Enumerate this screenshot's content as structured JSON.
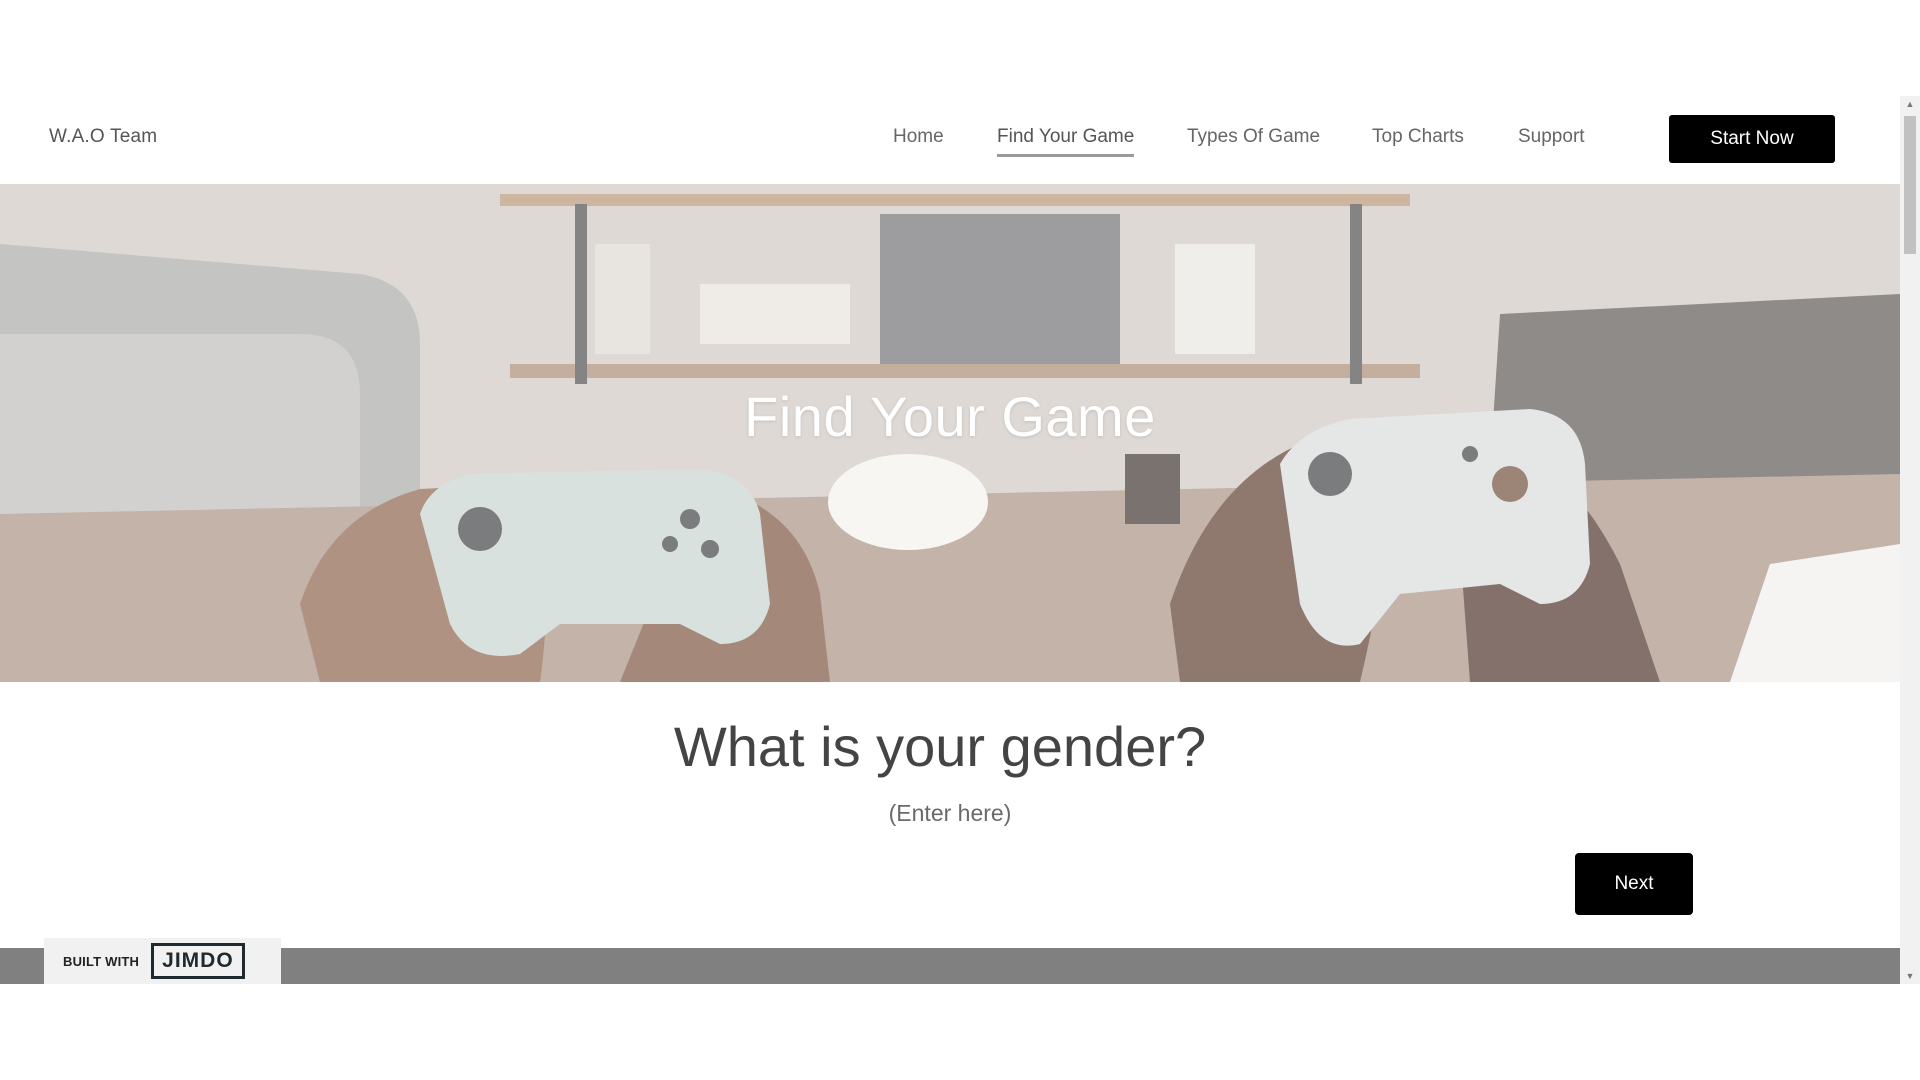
{
  "header": {
    "brand": "W.A.O Team",
    "nav": [
      {
        "label": "Home",
        "active": false
      },
      {
        "label": "Find Your Game",
        "active": true
      },
      {
        "label": "Types Of Game",
        "active": false
      },
      {
        "label": "Top Charts",
        "active": false
      },
      {
        "label": "Support",
        "active": false
      }
    ],
    "cta_label": "Start Now"
  },
  "hero": {
    "title": "Find Your Game"
  },
  "form": {
    "question": "What is your gender?",
    "hint": "(Enter here)",
    "next_label": "Next"
  },
  "footer": {
    "badge_prefix": "BUILT WITH",
    "badge_logo": "JIMDO"
  },
  "colors": {
    "button_bg": "#000000",
    "button_text": "#ffffff",
    "footer_band": "#808080",
    "active_underline": "#9a9a9a"
  },
  "icons": [
    "scroll-up-arrow-icon",
    "scroll-down-arrow-icon"
  ]
}
